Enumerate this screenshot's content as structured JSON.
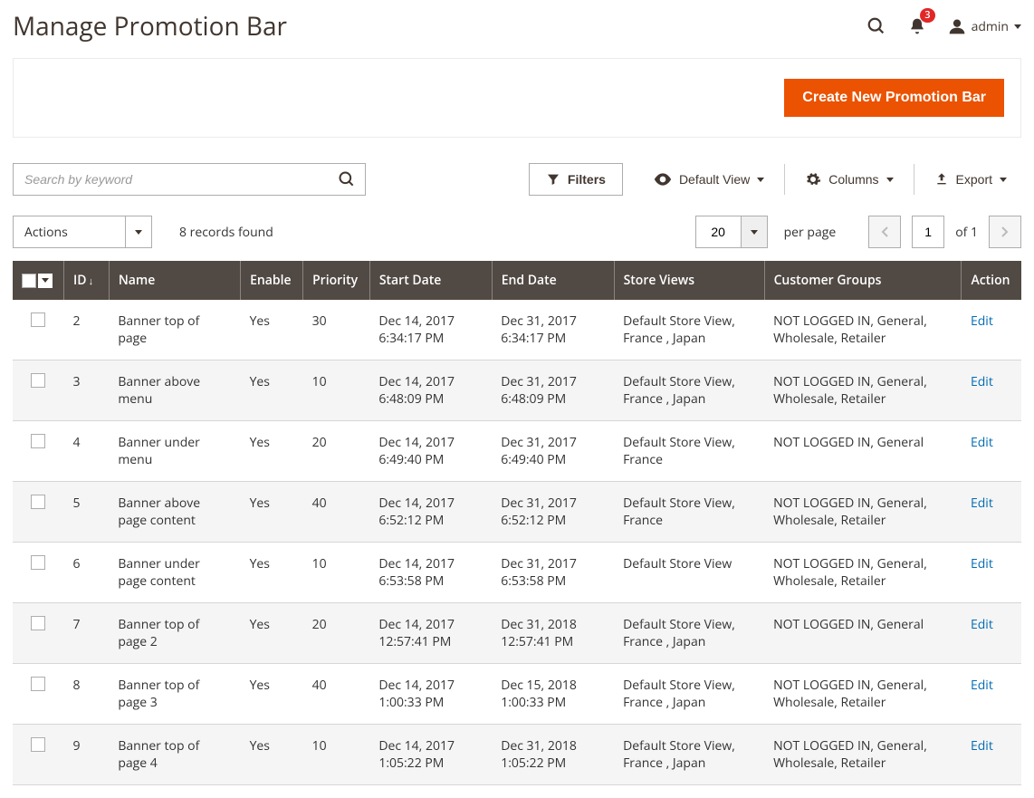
{
  "page_title": "Manage Promotion Bar",
  "header": {
    "notification_count": "3",
    "user_label": "admin"
  },
  "primary_button": "Create New Promotion Bar",
  "search": {
    "placeholder": "Search by keyword"
  },
  "toolbar": {
    "filters": "Filters",
    "default_view": "Default View",
    "columns": "Columns",
    "export": "Export"
  },
  "actions_label": "Actions",
  "records_found": "8 records found",
  "pager": {
    "per_page_value": "20",
    "per_page_label": "per page",
    "page_value": "1",
    "of_label": "of",
    "total_pages": "1"
  },
  "columns": {
    "id": "ID",
    "name": "Name",
    "enable": "Enable",
    "priority": "Priority",
    "start_date": "Start Date",
    "end_date": "End Date",
    "store_views": "Store Views",
    "customer_groups": "Customer Groups",
    "action": "Action"
  },
  "action_link": "Edit",
  "rows": [
    {
      "id": "2",
      "name": "Banner top of page",
      "enable": "Yes",
      "priority": "30",
      "start": "Dec 14, 2017 6:34:17 PM",
      "end": "Dec 31, 2017 6:34:17 PM",
      "sv": "Default Store View, France , Japan",
      "cg": "NOT LOGGED IN, General, Wholesale, Retailer"
    },
    {
      "id": "3",
      "name": "Banner above menu",
      "enable": "Yes",
      "priority": "10",
      "start": "Dec 14, 2017 6:48:09 PM",
      "end": "Dec 31, 2017 6:48:09 PM",
      "sv": "Default Store View, France , Japan",
      "cg": "NOT LOGGED IN, General, Wholesale, Retailer"
    },
    {
      "id": "4",
      "name": "Banner under menu",
      "enable": "Yes",
      "priority": "20",
      "start": "Dec 14, 2017 6:49:40 PM",
      "end": "Dec 31, 2017 6:49:40 PM",
      "sv": "Default Store View, France",
      "cg": "NOT LOGGED IN, General"
    },
    {
      "id": "5",
      "name": "Banner above page content",
      "enable": "Yes",
      "priority": "40",
      "start": "Dec 14, 2017 6:52:12 PM",
      "end": "Dec 31, 2017 6:52:12 PM",
      "sv": "Default Store View, France",
      "cg": "NOT LOGGED IN, General, Wholesale, Retailer"
    },
    {
      "id": "6",
      "name": "Banner under page content",
      "enable": "Yes",
      "priority": "10",
      "start": "Dec 14, 2017 6:53:58 PM",
      "end": "Dec 31, 2017 6:53:58 PM",
      "sv": "Default Store View",
      "cg": "NOT LOGGED IN, General, Wholesale, Retailer"
    },
    {
      "id": "7",
      "name": "Banner top of page 2",
      "enable": "Yes",
      "priority": "20",
      "start": "Dec 14, 2017 12:57:41 PM",
      "end": "Dec 31, 2018 12:57:41 PM",
      "sv": "Default Store View, France , Japan",
      "cg": "NOT LOGGED IN, General"
    },
    {
      "id": "8",
      "name": "Banner top of page 3",
      "enable": "Yes",
      "priority": "40",
      "start": "Dec 14, 2017 1:00:33 PM",
      "end": "Dec 15, 2018 1:00:33 PM",
      "sv": "Default Store View, France , Japan",
      "cg": "NOT LOGGED IN, General, Wholesale, Retailer"
    },
    {
      "id": "9",
      "name": "Banner top of page 4",
      "enable": "Yes",
      "priority": "10",
      "start": "Dec 14, 2017 1:05:22 PM",
      "end": "Dec 31, 2018 1:05:22 PM",
      "sv": "Default Store View, France , Japan",
      "cg": "NOT LOGGED IN, General, Wholesale, Retailer"
    }
  ]
}
